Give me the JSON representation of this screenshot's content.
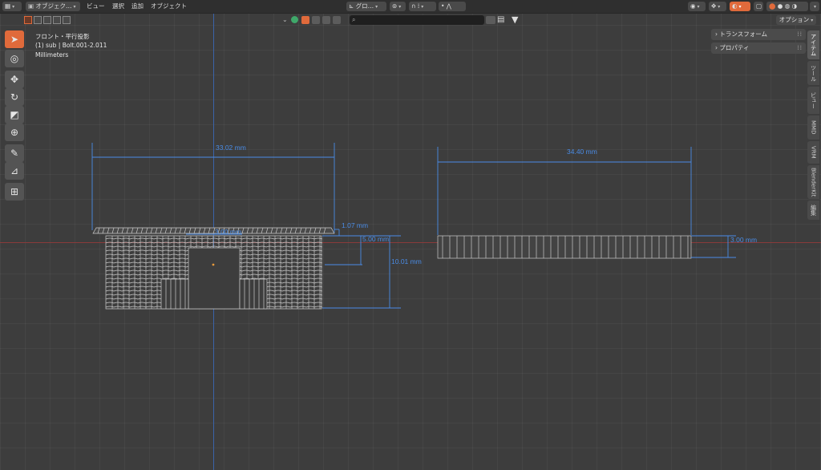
{
  "header": {
    "editor_type_icon": "viewport-icon",
    "mode_label": "オブジェク…",
    "menu": [
      "ビュー",
      "選択",
      "追加",
      "オブジェクト"
    ],
    "transform_orientation": "グロ…"
  },
  "viewport_overlay": {
    "view_name": "フロント・平行投影",
    "object_info": "(1) sub | Bolt.001-2.011",
    "units": "Millimeters"
  },
  "options_label": "オプション",
  "search": {
    "placeholder": ""
  },
  "npanel": {
    "panels": [
      "トランスフォーム",
      "プロパティ"
    ]
  },
  "sidebar_tabs": [
    "アイテム",
    "ツール",
    "ビュー",
    "MMD",
    "VRM",
    "BlenderKit",
    "編集"
  ],
  "measurements": {
    "left_width": "33.02 mm",
    "left_height_small": "1.07 mm",
    "left_inner": "3.00 mm",
    "left_mid": "5.00 mm",
    "left_total": "10.01 mm",
    "right_width": "34.40 mm",
    "right_height": "3.00 mm"
  },
  "colors": {
    "accent": "#e06a3b",
    "measure": "#4a8ce6",
    "axis_x": "#8a3b3b",
    "axis_y": "#3b63a8"
  }
}
